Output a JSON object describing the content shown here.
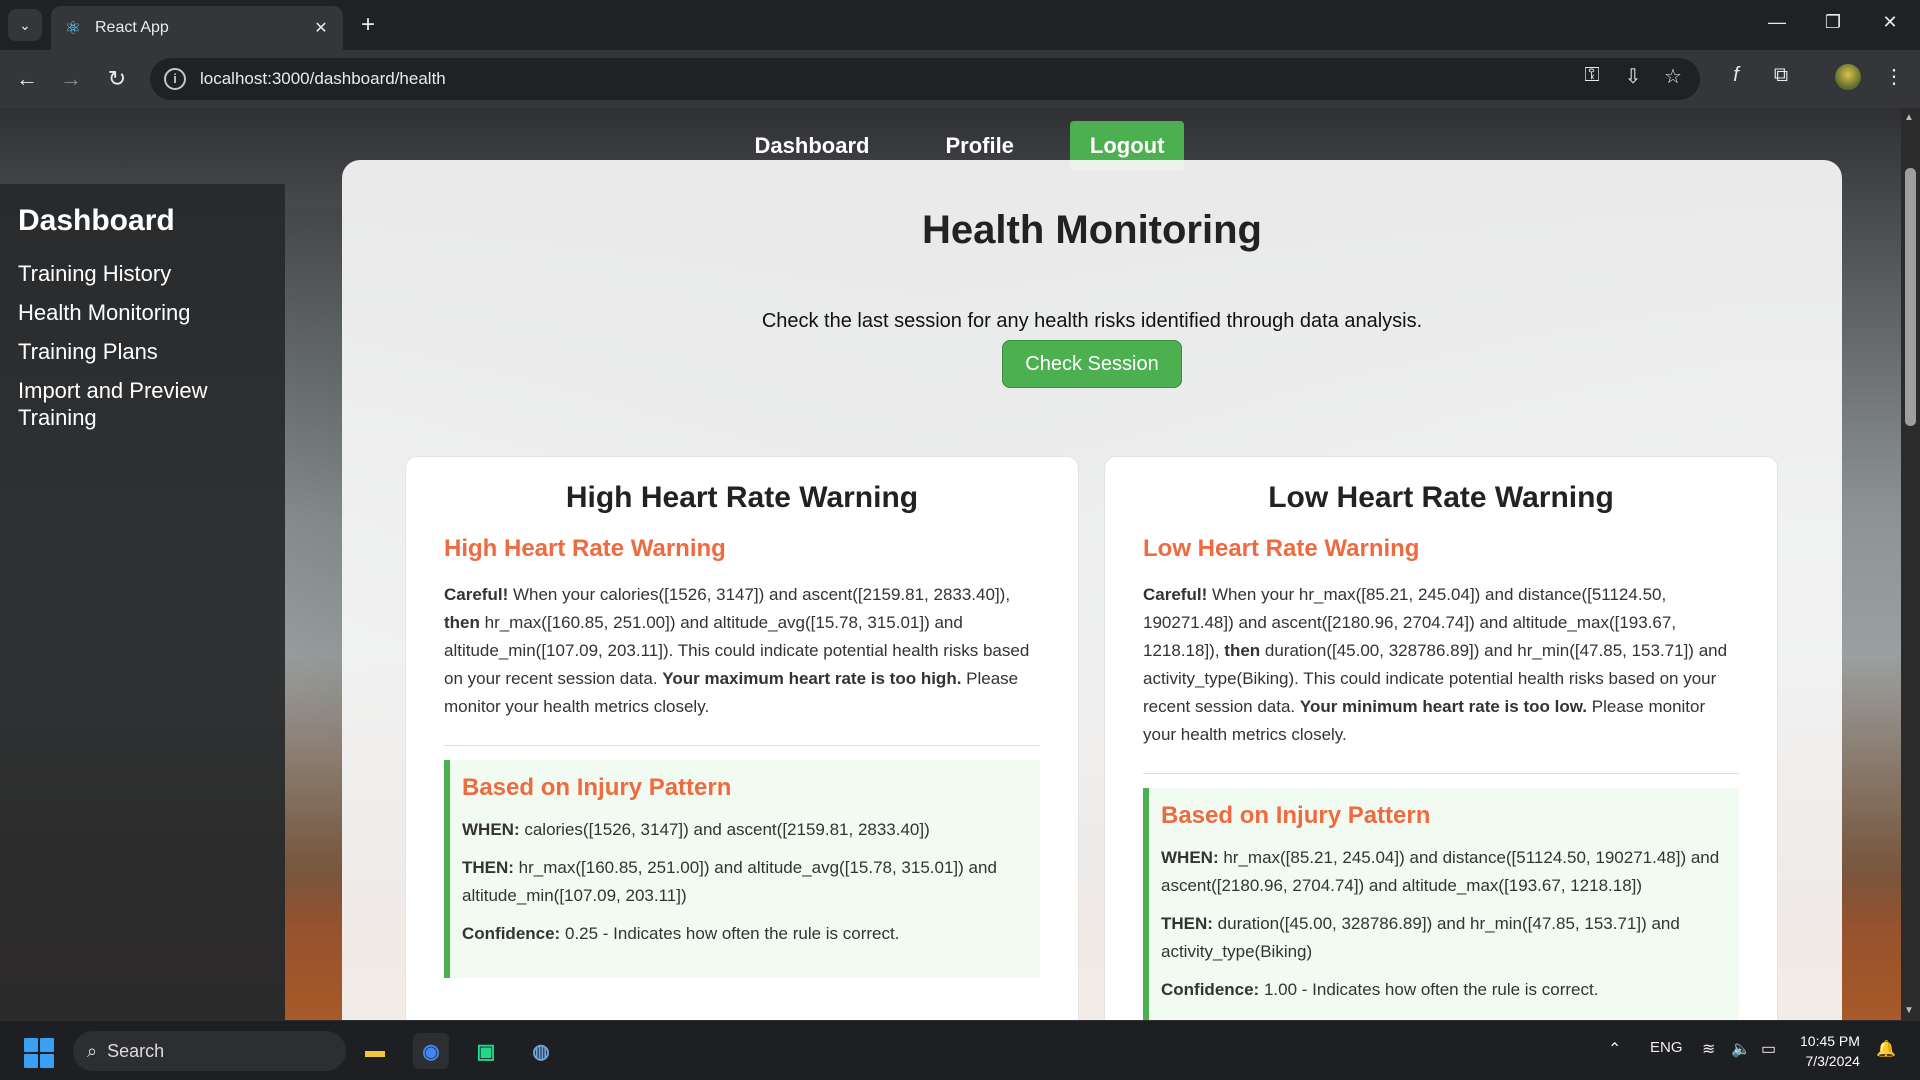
{
  "browser": {
    "tab_title": "React App",
    "url": "localhost:3000/dashboard/health",
    "tab_close": "✕",
    "new_tab": "+",
    "controls": {
      "minimize": "—",
      "restore": "❐",
      "close": "✕"
    }
  },
  "topnav": {
    "dashboard": "Dashboard",
    "profile": "Profile",
    "logout": "Logout"
  },
  "sidebar": {
    "title": "Dashboard",
    "items": [
      {
        "label": "Training History"
      },
      {
        "label": "Health Monitoring"
      },
      {
        "label": "Training Plans"
      },
      {
        "label": "Import and Preview Training"
      }
    ]
  },
  "main": {
    "title": "Health Monitoring",
    "intro": "Check the last session for any health risks identified through data analysis.",
    "check_button": "Check Session"
  },
  "cards": [
    {
      "heading": "High Heart Rate Warning",
      "subheading": "High Heart Rate Warning",
      "careful": "Careful!",
      "text_1": " When your calories([1526, 3147]) and ascent([2159.81, 2833.40]), ",
      "then": "then",
      "text_2": " hr_max([160.85, 251.00]) and altitude_avg([15.78, 315.01]) and altitude_min([107.09, 203.11]). This could indicate potential health risks based on your recent session data. ",
      "emphasis": "Your maximum heart rate is too high.",
      "text_3": " Please monitor your health metrics closely.",
      "pattern": {
        "title": "Based on Injury Pattern",
        "when_label": "WHEN:",
        "when": " calories([1526, 3147]) and ascent([2159.81, 2833.40])",
        "then_label": "THEN:",
        "then": " hr_max([160.85, 251.00]) and altitude_avg([15.78, 315.01]) and altitude_min([107.09, 203.11])",
        "confidence_label": "Confidence:",
        "confidence": " 0.25 - Indicates how often the rule is correct."
      }
    },
    {
      "heading": "Low Heart Rate Warning",
      "subheading": "Low Heart Rate Warning",
      "careful": "Careful!",
      "text_1": " When your hr_max([85.21, 245.04]) and distance([51124.50, 190271.48]) and ascent([2180.96, 2704.74]) and altitude_max([193.67, 1218.18]), ",
      "then": "then",
      "text_2": " duration([45.00, 328786.89]) and hr_min([47.85, 153.71]) and activity_type(Biking). This could indicate potential health risks based on your recent session data. ",
      "emphasis": "Your minimum heart rate is too low.",
      "text_3": " Please monitor your health metrics closely.",
      "pattern": {
        "title": "Based on Injury Pattern",
        "when_label": "WHEN:",
        "when": " hr_max([85.21, 245.04]) and distance([51124.50, 190271.48]) and ascent([2180.96, 2704.74]) and altitude_max([193.67, 1218.18])",
        "then_label": "THEN:",
        "then": " duration([45.00, 328786.89]) and hr_min([47.85, 153.71]) and activity_type(Biking)",
        "confidence_label": "Confidence:",
        "confidence": " 1.00 - Indicates how often the rule is correct."
      }
    }
  ],
  "taskbar": {
    "search": "Search",
    "lang": "ENG",
    "time": "10:45 PM",
    "date": "7/3/2024"
  },
  "colors": {
    "accent_green": "#4caf50",
    "warning_orange": "#ef6a3f"
  }
}
